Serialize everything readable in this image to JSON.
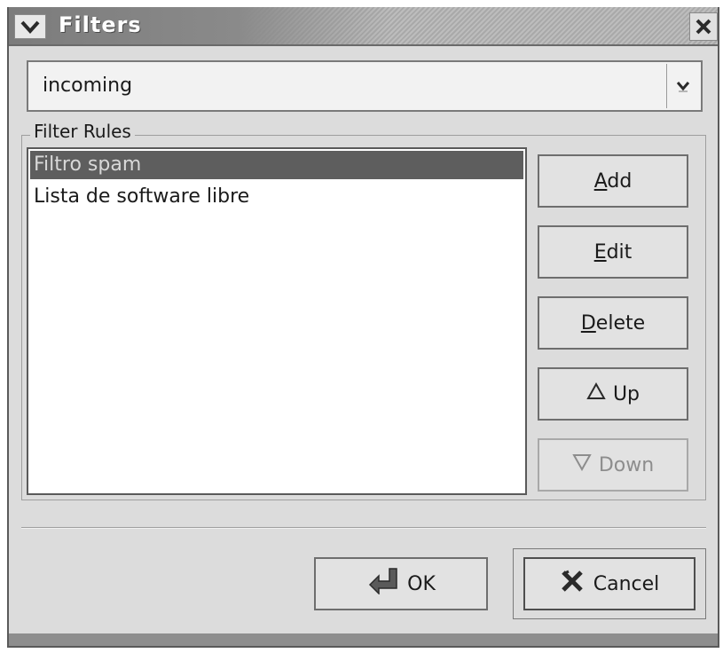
{
  "window": {
    "title": "Filters",
    "menu_icon": "chevron-down-icon",
    "close_icon": "close-icon"
  },
  "mailbox_selector": {
    "value": "incoming",
    "arrow_icon": "chevron-down-icon"
  },
  "filter_rules": {
    "label": "Filter Rules",
    "items": [
      {
        "label": "Filtro spam",
        "selected": true
      },
      {
        "label": "Lista de software libre",
        "selected": false
      }
    ]
  },
  "buttons": {
    "add": {
      "mnemonic": "A",
      "rest": "dd"
    },
    "edit": {
      "mnemonic": "E",
      "rest": "dit"
    },
    "delete": {
      "mnemonic": "D",
      "rest": "elete"
    },
    "up": {
      "label": "Up",
      "icon": "triangle-up-icon"
    },
    "down": {
      "label": "Down",
      "icon": "triangle-down-icon",
      "disabled": true
    }
  },
  "dialog_buttons": {
    "ok": {
      "label": "OK",
      "icon": "ok-arrow-icon"
    },
    "cancel": {
      "label": "Cancel",
      "icon": "cancel-x-icon"
    }
  }
}
